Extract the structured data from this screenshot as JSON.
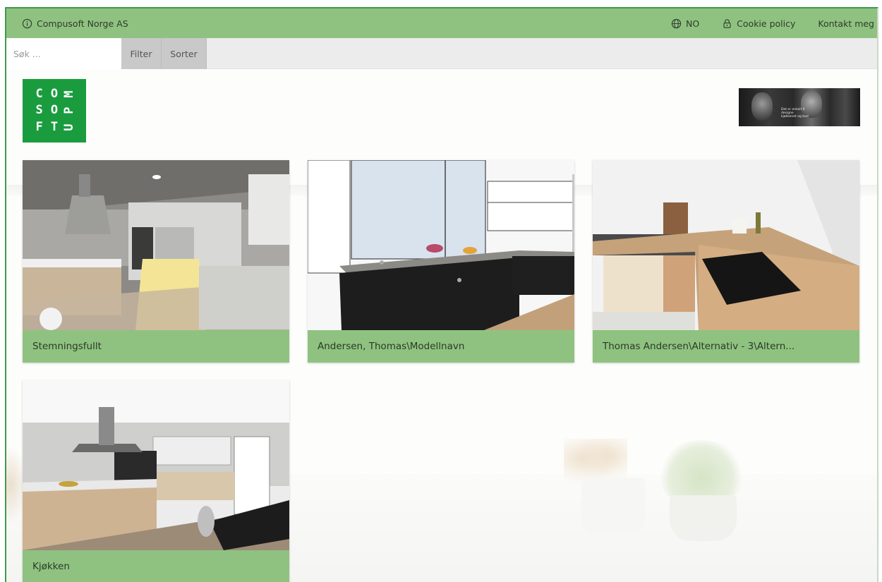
{
  "topbar": {
    "company": "Compusoft Norge AS",
    "language": "NO",
    "cookie": "Cookie policy",
    "contact": "Kontakt meg"
  },
  "search": {
    "placeholder": "Søk ...",
    "value": "",
    "filter_label": "Filter",
    "sort_label": "Sorter"
  },
  "logo": {
    "letters": [
      "C",
      "O",
      "M",
      "S",
      "O",
      "P",
      "F",
      "T",
      "U"
    ],
    "brand_color": "#1a9c3e"
  },
  "ad_banner": {
    "text": "Det er enkelt å designe kjøkkenet og bad"
  },
  "colors": {
    "accent": "#8fc280",
    "frame_border": "#3d9a4a"
  },
  "projects": [
    {
      "title": "Stemningsfullt"
    },
    {
      "title": "Andersen, Thomas\\Modellnavn"
    },
    {
      "title": "Thomas Andersen\\Alternativ - 3\\Altern..."
    },
    {
      "title": "Kjøkken"
    }
  ]
}
